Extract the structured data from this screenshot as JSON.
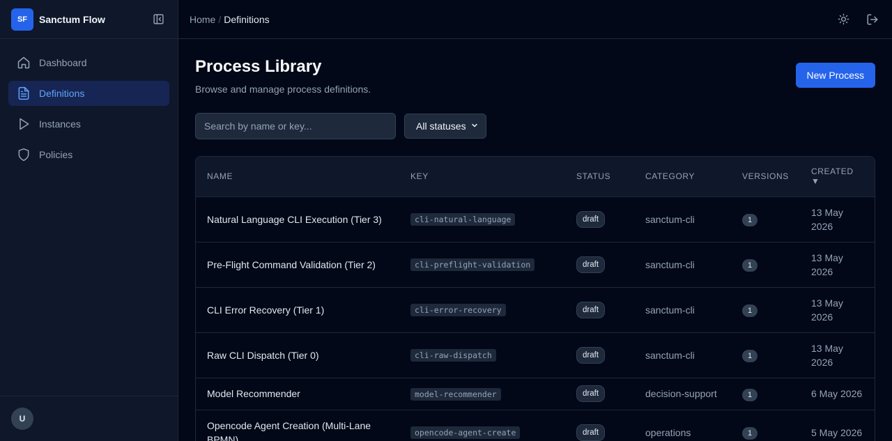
{
  "app": {
    "logo_text": "SF",
    "name": "Sanctum Flow"
  },
  "sidebar": {
    "items": [
      {
        "label": "Dashboard",
        "icon": "home-icon"
      },
      {
        "label": "Definitions",
        "icon": "document-icon",
        "active": true
      },
      {
        "label": "Instances",
        "icon": "play-icon"
      },
      {
        "label": "Policies",
        "icon": "shield-icon"
      }
    ],
    "user_initial": "U"
  },
  "breadcrumb": {
    "home": "Home",
    "separator": "/",
    "current": "Definitions"
  },
  "page": {
    "title": "Process Library",
    "subtitle": "Browse and manage process definitions.",
    "new_button": "New Process"
  },
  "filters": {
    "search_placeholder": "Search by name or key...",
    "status_selected": "All statuses"
  },
  "table": {
    "headers": {
      "name": "NAME",
      "key": "KEY",
      "status": "STATUS",
      "category": "CATEGORY",
      "versions": "VERSIONS",
      "created": "CREATED",
      "sort_indicator": "▼"
    },
    "rows": [
      {
        "name": "Natural Language CLI Execution (Tier 3)",
        "key": "cli-natural-language",
        "status": "draft",
        "category": "sanctum-cli",
        "versions": "1",
        "created": "13 May 2026"
      },
      {
        "name": "Pre-Flight Command Validation (Tier 2)",
        "key": "cli-preflight-validation",
        "status": "draft",
        "category": "sanctum-cli",
        "versions": "1",
        "created": "13 May 2026"
      },
      {
        "name": "CLI Error Recovery (Tier 1)",
        "key": "cli-error-recovery",
        "status": "draft",
        "category": "sanctum-cli",
        "versions": "1",
        "created": "13 May 2026"
      },
      {
        "name": "Raw CLI Dispatch (Tier 0)",
        "key": "cli-raw-dispatch",
        "status": "draft",
        "category": "sanctum-cli",
        "versions": "1",
        "created": "13 May 2026"
      },
      {
        "name": "Model Recommender",
        "key": "model-recommender",
        "status": "draft",
        "category": "decision-support",
        "versions": "1",
        "created": "6 May 2026"
      },
      {
        "name": "Opencode Agent Creation (Multi-Lane BPMN)",
        "key": "opencode-agent-create",
        "status": "draft",
        "category": "operations",
        "versions": "1",
        "created": "5 May 2026"
      }
    ]
  },
  "colors": {
    "accent": "#2563eb",
    "background": "#020817",
    "sidebar": "#0f172a"
  }
}
